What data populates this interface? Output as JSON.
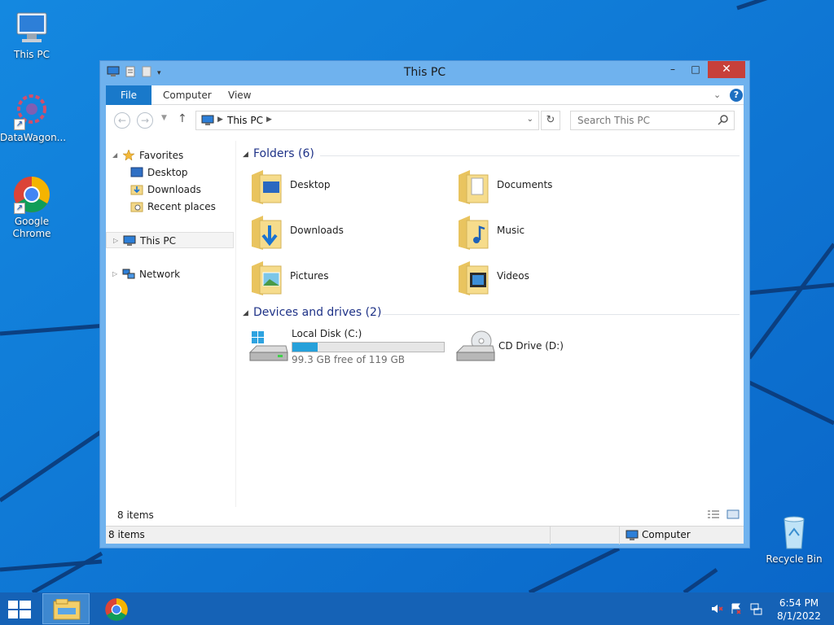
{
  "desktop": {
    "icons": [
      {
        "label": "This PC"
      },
      {
        "label": "DataWagon..."
      },
      {
        "label": "Google Chrome"
      },
      {
        "label": "Recycle Bin"
      }
    ]
  },
  "window": {
    "title": "This PC",
    "minimize": "–",
    "maximize": "□",
    "close": "✕"
  },
  "ribbon": {
    "tabs": [
      "File",
      "Computer",
      "View"
    ],
    "help": "?"
  },
  "navigation": {
    "back": "←",
    "forward": "→",
    "up": "↑",
    "address_path": "This PC",
    "search_placeholder": "Search This PC",
    "refresh": "↻"
  },
  "nav_pane": {
    "favorites": "Favorites",
    "favorite_items": [
      "Desktop",
      "Downloads",
      "Recent places"
    ],
    "this_pc": "This PC",
    "network": "Network"
  },
  "content": {
    "folders_header": "Folders (6)",
    "folders": [
      "Desktop",
      "Documents",
      "Downloads",
      "Music",
      "Pictures",
      "Videos"
    ],
    "devices_header": "Devices and drives (2)",
    "drives": [
      {
        "name": "Local Disk (C:)",
        "free_text": "99.3 GB free of 119 GB",
        "used_fraction": 0.166
      },
      {
        "name": "CD Drive (D:)"
      }
    ]
  },
  "status": {
    "items_count": "8 items",
    "bottom_left": "8 items",
    "bottom_right": "Computer"
  },
  "taskbar": {
    "time": "6:54 PM",
    "date": "8/1/2022"
  },
  "colors": {
    "desktop_blue": "#1a86d9",
    "taskbar": "#1562b6",
    "window_frame": "#6fb2ee",
    "file_tab": "#1979ca",
    "drive_bar": "#26a0da",
    "group_header": "#1e3287"
  }
}
